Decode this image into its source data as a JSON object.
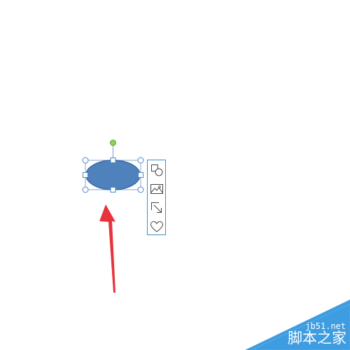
{
  "canvas": {
    "background": "#ffffff"
  },
  "shape": {
    "kind": "ellipse",
    "fill_color": "#4f81bd",
    "outline_color": "#3a6a9e",
    "selected": true,
    "handle_color": "#4a88c8",
    "rotate_handle_color": "#8ed15a"
  },
  "quick_toolbar": {
    "border_color": "#3c8fc8",
    "buttons": [
      {
        "icon": "layout-options-icon"
      },
      {
        "icon": "image-icon"
      },
      {
        "icon": "shape-effects-icon"
      },
      {
        "icon": "heart-icon"
      }
    ]
  },
  "annotation": {
    "arrow_color": "#e8323c"
  },
  "watermark": {
    "url": "jb51.net",
    "name": "脚本之家",
    "color": "#3d9de0"
  }
}
